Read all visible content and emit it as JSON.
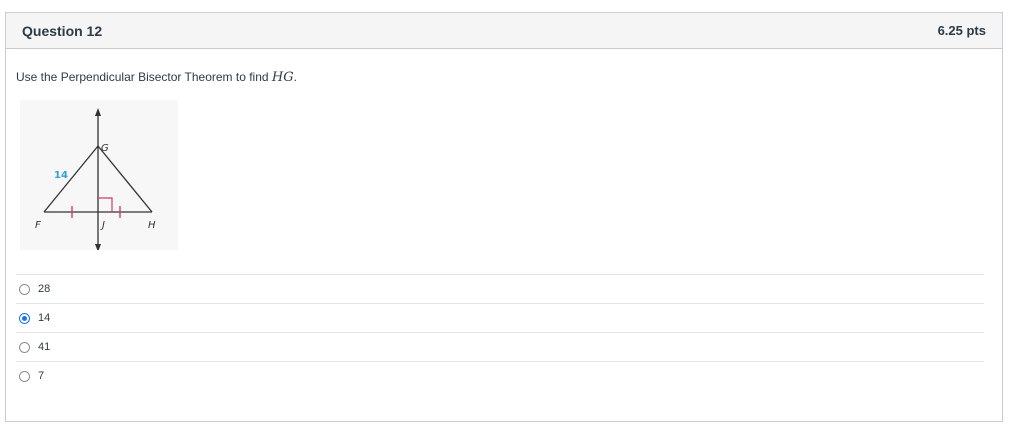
{
  "question": {
    "title": "Question 12",
    "points": "6.25 pts",
    "prompt_text": "Use the Perpendicular Bisector Theorem to find ",
    "prompt_math": "HG",
    "prompt_end": "."
  },
  "figure": {
    "labels": {
      "G": "G",
      "F": "F",
      "J": "J",
      "H": "H",
      "side": "14"
    },
    "colors": {
      "line": "#333333",
      "side_label": "#29a3d6",
      "marks": "#d03a6b"
    }
  },
  "answers": [
    {
      "label": "28",
      "selected": false
    },
    {
      "label": "14",
      "selected": true
    },
    {
      "label": "41",
      "selected": false
    },
    {
      "label": "7",
      "selected": false
    }
  ]
}
